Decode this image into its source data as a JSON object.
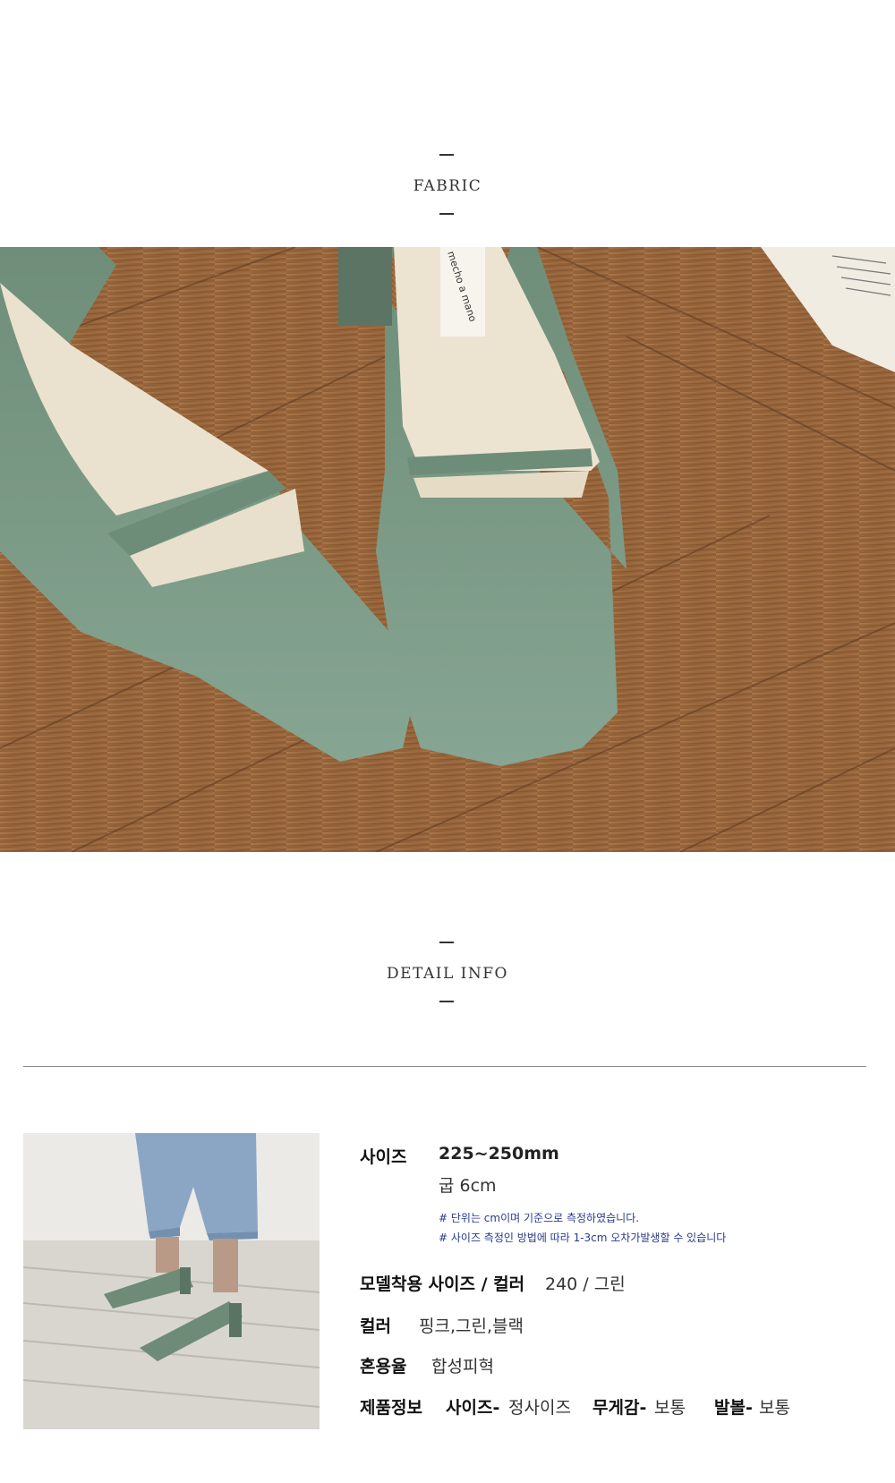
{
  "fabric": {
    "title": "FABRIC"
  },
  "detail": {
    "title": "DETAIL INFO"
  },
  "product_photo": {
    "insole_brand": "mecho a mano"
  },
  "info": {
    "size_label": "사이즈",
    "size_value": "225~250mm",
    "heel_value": "굽 6cm",
    "note1": "# 단위는 cm이며 기준으로 측정하였습니다.",
    "note2": "# 사이즈 측정인 방법에 따라 1-3cm 오차가발생할 수 있습니다",
    "model_label": "모델착용 사이즈 / 컬러",
    "model_value": "240 / 그린",
    "color_label": "컬러",
    "color_value": "핑크,그린,블랙",
    "material_label": "혼용율",
    "material_value": "합성피혁",
    "product_label": "제품정보",
    "fit_label": "사이즈-",
    "fit_value": "정사이즈",
    "weight_label": "무게감-",
    "weight_value": "보통",
    "width_label": "발볼-",
    "width_value": "보통"
  },
  "colors": {
    "shoe": "#7a9a85",
    "wood": "#9a6a40"
  }
}
